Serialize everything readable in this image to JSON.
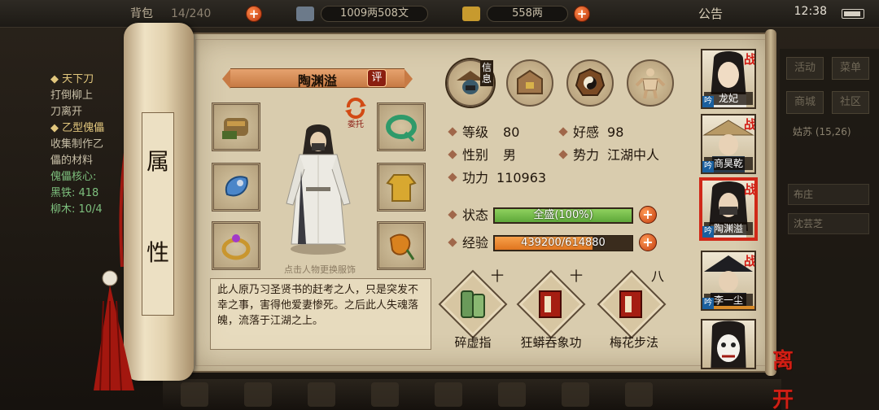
{
  "topbar": {
    "capacity_label": "背包",
    "capacity_value": "14/240",
    "money": "1009两508文",
    "gold": "558两",
    "notice": "公告",
    "time": "12:38"
  },
  "left_panel": {
    "quest1_title": "◆ 天下刀",
    "quest1_line1": "打倒柳上",
    "quest1_line2": "刀离开",
    "quest2_title": "◆ 乙型傀儡",
    "quest2_line1": "收集制作乙",
    "quest2_line2": "儡的材料",
    "quest2_line3": "傀儡核心:",
    "quest2_line4": "黑铁: 418",
    "quest2_line5": "柳木: 10/4"
  },
  "right_menu": {
    "activity": "活动",
    "menu": "菜单",
    "shop": "商城",
    "community": "社区",
    "location": "姑苏",
    "coords": "(15,26)",
    "npc1": "布庄",
    "npc2": "沈芸芝"
  },
  "scroll": {
    "attribute_chars": [
      "属",
      "性"
    ]
  },
  "character": {
    "name": "陶渊溢",
    "eval_label": "评",
    "entrust_label": "委托",
    "change_hint": "点击人物更换服饰",
    "description": "此人原乃习圣贤书的赶考之人，只是突发不幸之事，害得他爱妻惨死。之后此人失魂落魄，流落于江湖之上。"
  },
  "tabs": {
    "info_label": "信息"
  },
  "stats": {
    "level_label": "等级",
    "level_value": "80",
    "favor_label": "好感",
    "favor_value": "98",
    "gender_label": "性别",
    "gender_value": "男",
    "faction_label": "势力",
    "faction_value": "江湖中人",
    "power_label": "功力",
    "power_value": "110963",
    "status_label": "状态",
    "status_text": "全盛(100%)",
    "status_fraction": 1.0,
    "exp_label": "经验",
    "exp_text": "439200/614880",
    "exp_fraction": 0.714
  },
  "skills": [
    {
      "name": "碎虚指",
      "level": "十"
    },
    {
      "name": "狂蟒吞象功",
      "level": "十"
    },
    {
      "name": "梅花步法",
      "level": "八"
    }
  ],
  "roster": [
    {
      "name": "龙妃",
      "battle": "战",
      "tag": "吟"
    },
    {
      "name": "商昊乾",
      "battle": "战",
      "tag": "吟"
    },
    {
      "name": "陶渊溢",
      "battle": "战",
      "tag": "吟"
    },
    {
      "name": "李一尘",
      "battle": "战",
      "tag": "吟"
    },
    {
      "name": "",
      "battle": "",
      "tag": ""
    }
  ],
  "leave_label": "离开",
  "colors": {
    "status_fill": "#5fa83a",
    "exp_fill": "#e0751f",
    "accent_red": "#d02818"
  }
}
